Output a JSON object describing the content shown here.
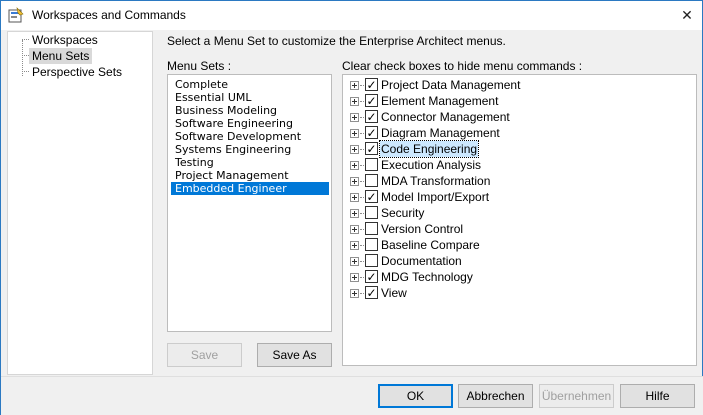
{
  "window": {
    "title": "Workspaces and Commands",
    "icon": "app-icon",
    "close_glyph": "✕"
  },
  "left_nav": {
    "items": [
      {
        "label": "Workspaces",
        "selected": false
      },
      {
        "label": "Menu Sets",
        "selected": true
      },
      {
        "label": "Perspective Sets",
        "selected": false
      }
    ]
  },
  "main": {
    "instruction": "Select a Menu Set to customize the Enterprise Architect menus.",
    "menu_sets_label": "Menu Sets :",
    "menu_sets": [
      {
        "label": "Complete",
        "selected": false
      },
      {
        "label": "Essential UML",
        "selected": false
      },
      {
        "label": "Business Modeling",
        "selected": false
      },
      {
        "label": "Software Engineering",
        "selected": false
      },
      {
        "label": "Software Development",
        "selected": false
      },
      {
        "label": "Systems Engineering",
        "selected": false
      },
      {
        "label": "Testing",
        "selected": false
      },
      {
        "label": "Project Management",
        "selected": false
      },
      {
        "label": "Embedded Engineer",
        "selected": true
      }
    ],
    "save_label": "Save",
    "save_as_label": "Save As",
    "commands_label": "Clear check boxes to hide menu commands :",
    "commands": [
      {
        "label": "Project Data Management",
        "checked": true
      },
      {
        "label": "Element Management",
        "checked": true
      },
      {
        "label": "Connector Management",
        "checked": true
      },
      {
        "label": "Diagram Management",
        "checked": true
      },
      {
        "label": "Code Engineering",
        "checked": true,
        "focused": true
      },
      {
        "label": "Execution Analysis",
        "checked": false
      },
      {
        "label": "MDA Transformation",
        "checked": false
      },
      {
        "label": "Model Import/Export",
        "checked": true
      },
      {
        "label": "Security",
        "checked": false
      },
      {
        "label": "Version Control",
        "checked": false
      },
      {
        "label": "Baseline Compare",
        "checked": false
      },
      {
        "label": "Documentation",
        "checked": false
      },
      {
        "label": "MDG Technology",
        "checked": true
      },
      {
        "label": "View",
        "checked": true
      }
    ]
  },
  "footer": {
    "ok_label": "OK",
    "cancel_label": "Abbrechen",
    "apply_label": "Übernehmen",
    "help_label": "Hilfe"
  },
  "colors": {
    "accent": "#0078d7",
    "window_border": "#2b79c2"
  }
}
